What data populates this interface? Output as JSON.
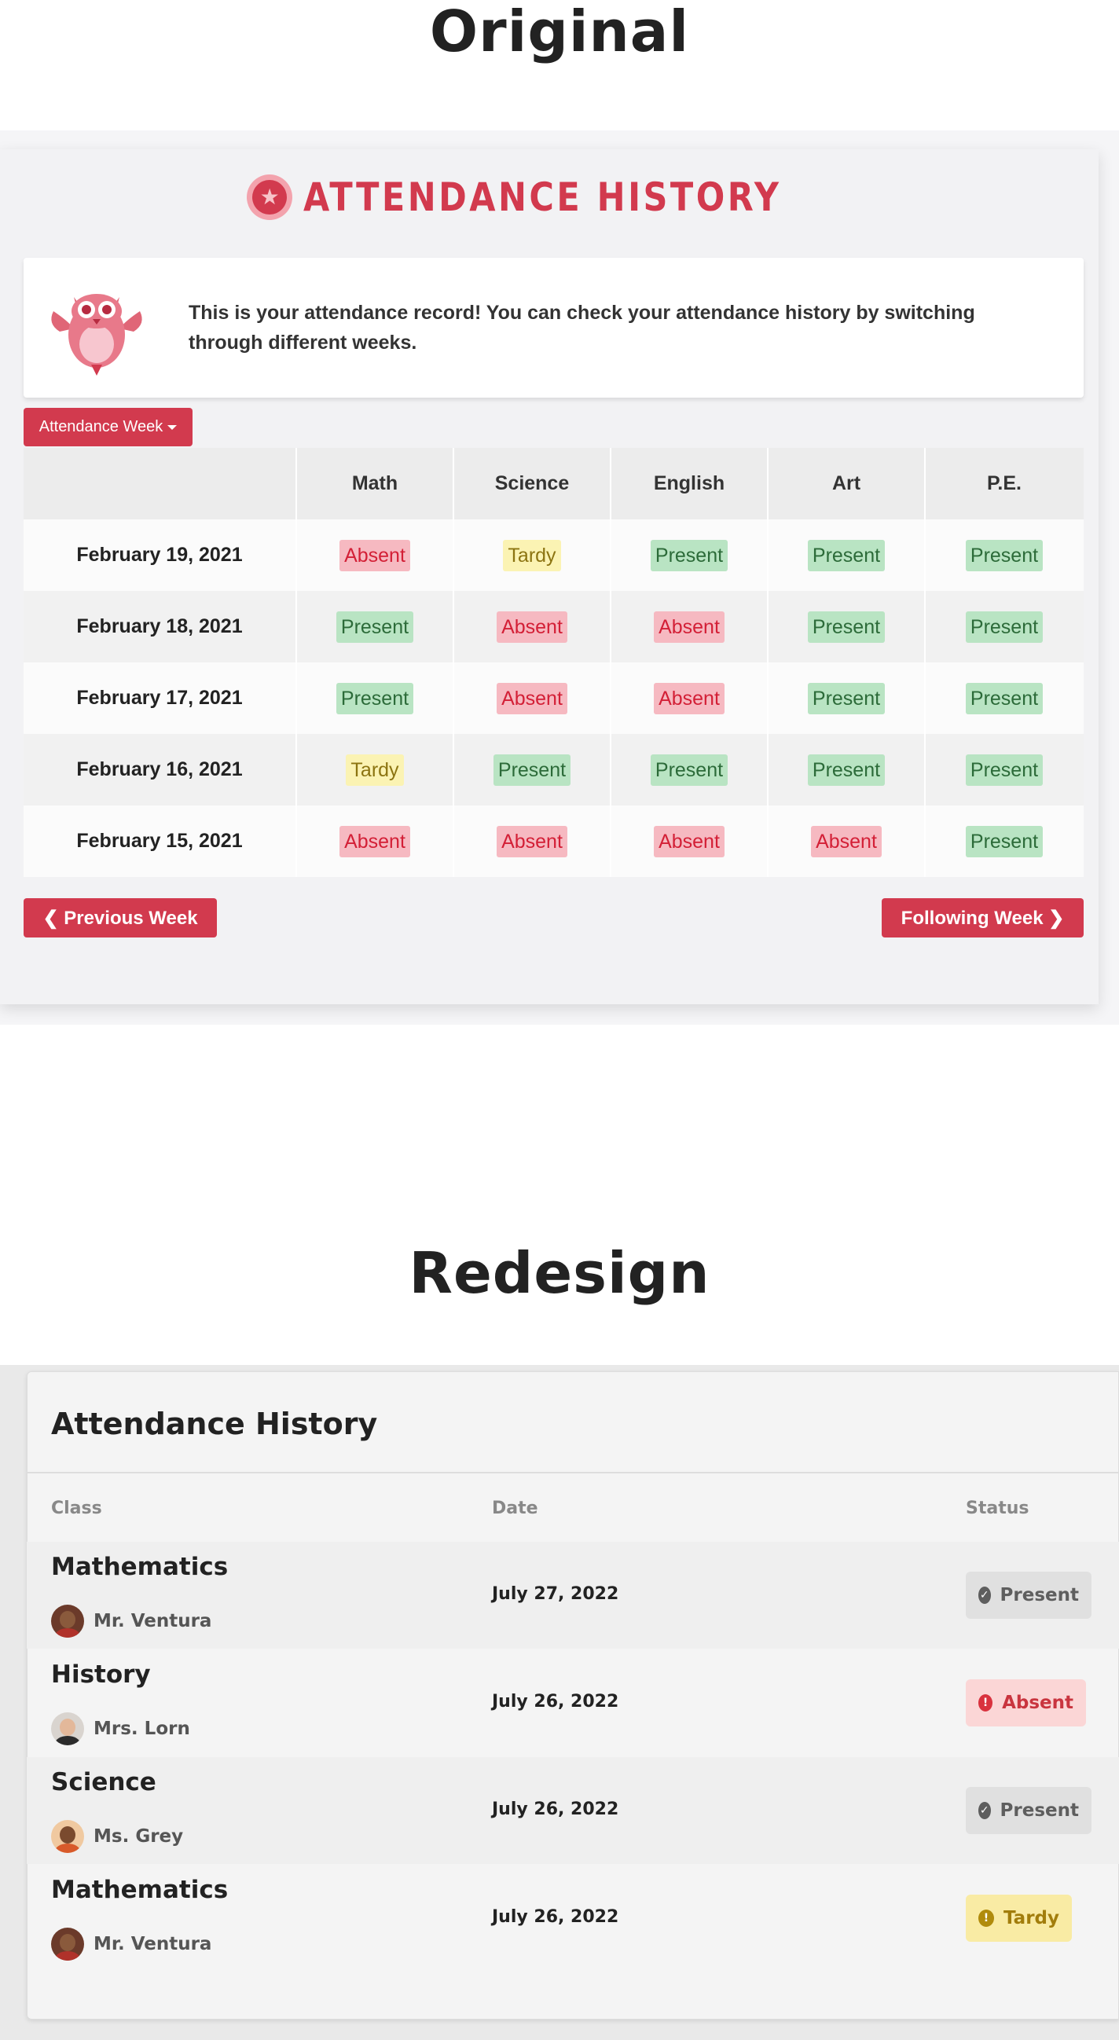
{
  "headings": {
    "original": "Original",
    "redesign": "Redesign"
  },
  "original": {
    "title": "ATTENDANCE HISTORY",
    "intro": "This is your attendance record! You can check your attendance history by switching through different weeks.",
    "week_dropdown": "Attendance Week",
    "columns": [
      "Math",
      "Science",
      "English",
      "Art",
      "P.E."
    ],
    "rows": [
      {
        "date": "February 19, 2021",
        "statuses": [
          "Absent",
          "Tardy",
          "Present",
          "Present",
          "Present"
        ]
      },
      {
        "date": "February 18, 2021",
        "statuses": [
          "Present",
          "Absent",
          "Absent",
          "Present",
          "Present"
        ]
      },
      {
        "date": "February 17, 2021",
        "statuses": [
          "Present",
          "Absent",
          "Absent",
          "Present",
          "Present"
        ]
      },
      {
        "date": "February 16, 2021",
        "statuses": [
          "Tardy",
          "Present",
          "Present",
          "Present",
          "Present"
        ]
      },
      {
        "date": "February 15, 2021",
        "statuses": [
          "Absent",
          "Absent",
          "Absent",
          "Absent",
          "Present"
        ]
      }
    ],
    "prev_button": "❮ Previous Week",
    "next_button": "Following Week ❯",
    "colors": {
      "accent": "#d23a4e",
      "present_bg": "#b9e4c3",
      "absent_bg": "#f6b9c1",
      "tardy_bg": "#fbf3b3"
    }
  },
  "redesign": {
    "title": "Attendance History",
    "columns": {
      "class": "Class",
      "date": "Date",
      "status": "Status"
    },
    "rows": [
      {
        "class": "Mathematics",
        "teacher": "Mr. Ventura",
        "date": "July 27, 2022",
        "status": "Present",
        "icon": "check-circle-icon"
      },
      {
        "class": "History",
        "teacher": "Mrs. Lorn",
        "date": "July 26, 2022",
        "status": "Absent",
        "icon": "alert-circle-icon"
      },
      {
        "class": "Science",
        "teacher": "Ms. Grey",
        "date": "July 26, 2022",
        "status": "Present",
        "icon": "check-circle-icon"
      },
      {
        "class": "Mathematics",
        "teacher": "Mr. Ventura",
        "date": "July 26, 2022",
        "status": "Tardy",
        "icon": "alert-circle-icon"
      }
    ],
    "colors": {
      "present_bg": "#e0e0e0",
      "absent_bg": "#fbd6d6",
      "tardy_bg": "#f9eba4"
    }
  }
}
